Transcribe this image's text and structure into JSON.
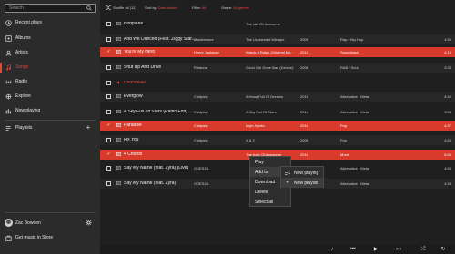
{
  "search": {
    "placeholder": "Search"
  },
  "sidebar": {
    "items": [
      {
        "label": "Recent plays",
        "icon": "clock-icon"
      },
      {
        "label": "Albums",
        "icon": "album-icon"
      },
      {
        "label": "Artists",
        "icon": "person-icon"
      },
      {
        "label": "Songs",
        "icon": "music-note-icon",
        "active": true
      },
      {
        "label": "Radio",
        "icon": "radio-icon"
      },
      {
        "label": "Explore",
        "icon": "explore-icon"
      },
      {
        "label": "Now playing",
        "icon": "now-playing-icon"
      }
    ],
    "playlists_label": "Playlists",
    "user_name": "Zac Bowden",
    "store_label": "Get music in Store"
  },
  "toolbar": {
    "shuffle_label": "Shuffle all (12)",
    "sort_key": "Sort by:",
    "sort_value": "Date added",
    "filter_key": "Filter:",
    "filter_value": "All",
    "genre_key": "Genre:",
    "genre_value": "All genres"
  },
  "songs": [
    {
      "title": "Birdplane",
      "artist": "",
      "album": "The Ials Of Awesome",
      "year": "",
      "genre": "",
      "duration": ""
    },
    {
      "title": "And We Danced (Feat. Ziggy Star...",
      "artist": "Macklemore",
      "album": "The Unplanned Mixtape",
      "year": "2009",
      "genre": "Rap / Hip-Hop",
      "duration": "4:56"
    },
    {
      "title": "You're My Hero",
      "artist": "Henry Jackman",
      "album": "Wreck-It Ralph (Original Mo...",
      "year": "2012",
      "genre": "Soundtrack",
      "duration": "4:15"
    },
    {
      "title": "Shut Up And Drive",
      "artist": "Rihanna",
      "album": "Good Girl Gone Bad (Deluxe)",
      "year": "2008",
      "genre": "R&B / Soul",
      "duration": "3:33"
    },
    {
      "title": "Chandelier",
      "artist": "",
      "album": "",
      "year": "",
      "genre": "",
      "duration": ""
    },
    {
      "title": "Everglow",
      "artist": "Coldplay",
      "album": "A Head Full Of Dreams",
      "year": "2015",
      "genre": "Alternative / Metal",
      "duration": "4:42"
    },
    {
      "title": "A Sky Full Of Stars (Radio Edit)",
      "artist": "Coldplay",
      "album": "A Sky Full Of Stars",
      "year": "2014",
      "genre": "Alternative / Metal",
      "duration": "3:53"
    },
    {
      "title": "Paradise",
      "artist": "Coldplay",
      "album": "Mylo Xyloto",
      "year": "2011",
      "genre": "Pop",
      "duration": "4:37"
    },
    {
      "title": "Fix You",
      "artist": "Coldplay",
      "album": "X & Y",
      "year": "2005",
      "genre": "Pop",
      "duration": "4:54"
    },
    {
      "title": "4 Chords",
      "artist": "",
      "album": "The Axis Of Awesome",
      "year": "2011",
      "genre": "More",
      "duration": "5:46"
    },
    {
      "title": "Say My Name (feat. Zyra) (Live)",
      "artist": "ODESZA",
      "album": "",
      "year": "2014",
      "genre": "Alternative / Metal",
      "duration": "4:55"
    },
    {
      "title": "Say My Name (feat. Zyra)",
      "artist": "ODESZA",
      "album": "",
      "year": "2014",
      "genre": "Alternative / Metal",
      "duration": "4:23"
    }
  ],
  "context_menu": {
    "items": [
      "Play",
      "Add to",
      "Download",
      "Delete",
      "Select all"
    ]
  },
  "submenu": {
    "items": [
      "Now playing",
      "New playlist"
    ]
  },
  "colors": {
    "accent": "#d83b2b",
    "sidebar_bg": "#2b2b2b",
    "content_bg": "#1f1f1f"
  }
}
